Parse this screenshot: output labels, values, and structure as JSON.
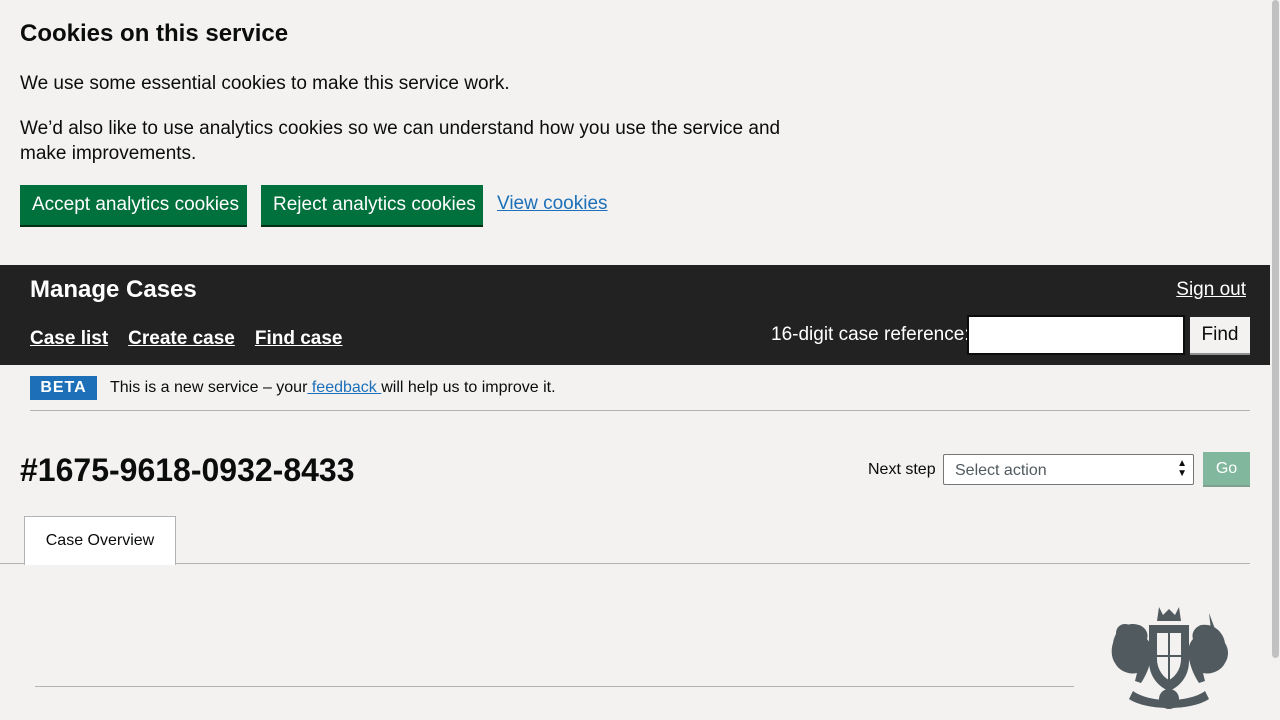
{
  "cookie_banner": {
    "title": "Cookies on this service",
    "paragraph1": "We use some essential cookies to make this service work.",
    "paragraph2": "We’d also like to use analytics cookies so we can understand how you use the service and make improvements.",
    "accept_label": "Accept analytics cookies",
    "reject_label": "Reject analytics cookies",
    "view_label": "View cookies"
  },
  "header": {
    "title": "Manage Cases",
    "sign_out": "Sign out",
    "nav": [
      "Case list",
      "Create case",
      "Find case"
    ],
    "case_ref_label": "16-digit case reference:",
    "case_ref_value": "",
    "find_label": "Find"
  },
  "phase_banner": {
    "tag": "BETA",
    "text_before": "This is a new service – your",
    "link": " feedback ",
    "text_after": " will help us to improve it."
  },
  "case": {
    "number": "#1675-9618-0932-8433",
    "next_step_label": "Next step",
    "select_value": "Select action",
    "go_label": "Go"
  },
  "tabs": [
    {
      "label": "Case Overview",
      "selected": true
    }
  ],
  "colors": {
    "button_green": "#00703c",
    "header_bg": "#222222",
    "link_blue": "#1d70b8",
    "page_bg": "#f3f2f1"
  },
  "icons": {
    "crest": "royal-coat-of-arms-icon",
    "select_arrows": "select-arrows-icon"
  }
}
